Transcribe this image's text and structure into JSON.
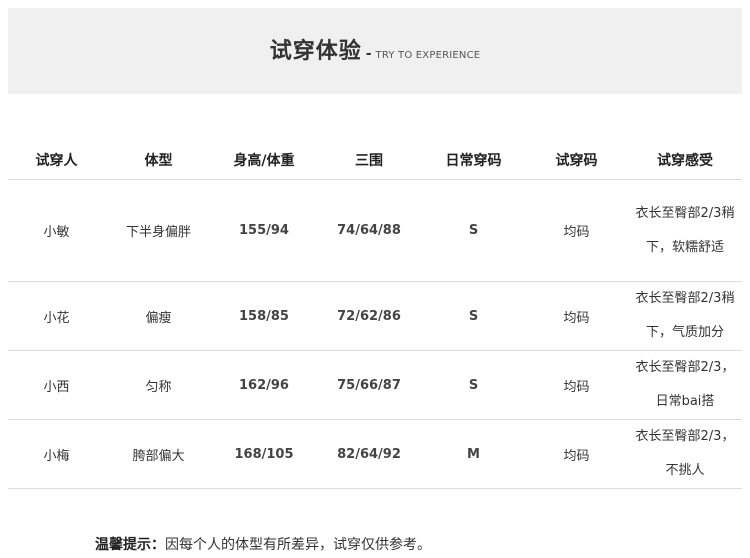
{
  "header": {
    "title_cn": "试穿体验",
    "dash": "-",
    "title_en": "TRY TO EXPERIENCE"
  },
  "table": {
    "columns": [
      "试穿人",
      "体型",
      "身高/体重",
      "三围",
      "日常穿码",
      "试穿码",
      "试穿感受"
    ],
    "rows": [
      {
        "name": "小敏",
        "body": "下半身偏胖",
        "hw": "155/94",
        "measure": "74/64/88",
        "daily": "S",
        "try": "均码",
        "feel": "衣长至臀部2/3稍下，软糯舒适"
      },
      {
        "name": "小花",
        "body": "偏瘦",
        "hw": "158/85",
        "measure": "72/62/86",
        "daily": "S",
        "try": "均码",
        "feel": "衣长至臀部2/3稍下，气质加分"
      },
      {
        "name": "小西",
        "body": "匀称",
        "hw": "162/96",
        "measure": "75/66/87",
        "daily": "S",
        "try": "均码",
        "feel": "衣长至臀部2/3，日常bai搭"
      },
      {
        "name": "小梅",
        "body": "胯部偏大",
        "hw": "168/105",
        "measure": "82/64/92",
        "daily": "M",
        "try": "均码",
        "feel": "衣长至臀部2/3，不挑人"
      }
    ]
  },
  "footer": {
    "label": "温馨提示：",
    "text": "因每个人的体型有所差异，试穿仅供参考。"
  }
}
